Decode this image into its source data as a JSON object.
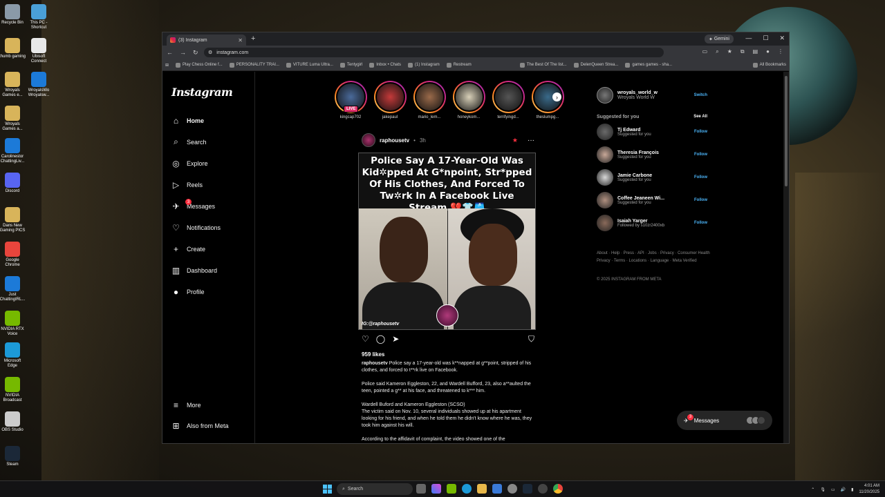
{
  "desktop": {
    "icons": [
      {
        "label": "Recycle Bin",
        "color": "#8a9aa8"
      },
      {
        "label": "This PC - Shortcut",
        "color": "#4aa0d8"
      },
      {
        "label": "thumb gaming",
        "color": "#d8b45a"
      },
      {
        "label": "Ubisoft Connect",
        "color": "#e8e8e8"
      },
      {
        "label": "Wroyals Games e...",
        "color": "#d8b45a"
      },
      {
        "label": "WroyalsWo Wroyalsw...",
        "color": "#1c7ad8"
      },
      {
        "label": "Wroyals Games a...",
        "color": "#d8b45a"
      },
      {
        "label": "Carolinestor ChattingLiv...",
        "color": "#1c7ad8"
      },
      {
        "label": "Discord",
        "color": "#5865f2"
      },
      {
        "label": "Dans New Gaming PICS",
        "color": "#d8b45a"
      },
      {
        "label": "Google Chrome",
        "color": "#e8453c"
      },
      {
        "label": "Just ChattingIRL...",
        "color": "#1c7ad8"
      },
      {
        "label": "NVIDIA RTX Voice",
        "color": "#76b900"
      },
      {
        "label": "Microsoft Edge",
        "color": "#1c9ad8"
      },
      {
        "label": "NVIDIA Broadcast",
        "color": "#76b900"
      },
      {
        "label": "OBS Studio",
        "color": "#cccccc"
      },
      {
        "label": "Steam",
        "color": "#1b2838"
      }
    ]
  },
  "browser": {
    "tab_title": "(3) Instagram",
    "gemini_label": "Gemini",
    "url": "instagram.com",
    "bookmarks": [
      "Play Chess Online f...",
      "PERSONALITY TRAI...",
      "VITURE Luma Ultra...",
      "Tentygirl",
      "Inbox • Chats",
      "(1) Instagram",
      "Restream",
      "The Best Of The list...",
      "DelenQueen Strea...",
      "games games - sha...",
      "All Bookmarks"
    ]
  },
  "instagram": {
    "logo": "Instagram",
    "nav": [
      {
        "label": "Home",
        "icon": "⌂"
      },
      {
        "label": "Search",
        "icon": "⌕"
      },
      {
        "label": "Explore",
        "icon": "◎"
      },
      {
        "label": "Reels",
        "icon": "▷"
      },
      {
        "label": "Messages",
        "icon": "✈"
      },
      {
        "label": "Notifications",
        "icon": "♡"
      },
      {
        "label": "Create",
        "icon": "+"
      },
      {
        "label": "Dashboard",
        "icon": "▥"
      },
      {
        "label": "Profile",
        "icon": "●"
      }
    ],
    "messages_badge": "3",
    "more_label": "More",
    "also_meta_label": "Also from Meta",
    "stories": [
      {
        "name": "kingcap702",
        "color": "#4a6a9a"
      },
      {
        "name": "jakepaul",
        "color": "#c43a3a"
      },
      {
        "name": "mario_lem...",
        "color": "#9a6a4a"
      },
      {
        "name": "honeykom...",
        "color": "#d8d0b8"
      },
      {
        "name": "terrifyingd...",
        "color": "#555"
      },
      {
        "name": "theslumpg...",
        "color": "#3a6a8a"
      }
    ],
    "live_label": "LIVE",
    "post": {
      "username": "raphousetv",
      "time": "3h",
      "headline": "Police Say A 17-Year-Old Was Kid✲pped At G*npoint, Str*pped Of His Clothes, And Forced To Tw✲rk In A Facebook Live Stream.💔👕🩳",
      "watermark": "IG:@raphousetv",
      "likes": "959 likes",
      "caption": [
        "Police say a 17-year-old was k**napped at g**point, stripped of his clothes, and forced to t**rk live on Facebook.",
        "Police said Kameron Eggleston, 22, and Wardell Bufford, 23, also a**aulted the teen, pointed a g** at his face, and threatened to k*** him.",
        "Wardell Buford and Kameron Eggleston (SCSO)\nThe victim said on Nov. 10, several individuals showed up at his apartment looking for his friend, and when he told them he didn't know where he was, they took him against his will.",
        "According to the affidavit of complaint, the video showed one of the"
      ]
    },
    "me": {
      "username": "wroyals_world_w",
      "name": "Wroyals World W",
      "switch": "Switch"
    },
    "suggested_title": "Suggested for you",
    "see_all": "See All",
    "suggestions": [
      {
        "name": "Tj Edward",
        "sub": "Suggested for you",
        "follow": "Follow"
      },
      {
        "name": "Theresia François",
        "sub": "Suggested for you",
        "follow": "Follow"
      },
      {
        "name": "Jamie Carbone",
        "sub": "Suggested for you",
        "follow": "Follow"
      },
      {
        "name": "Coffee Jeaneen Wi...",
        "sub": "Suggested for you",
        "follow": "Follow"
      },
      {
        "name": "Isaiah Yarger",
        "sub": "Followed by s10zr2400xb",
        "follow": "Follow"
      }
    ],
    "footer_links": "About · Help · Press · API · Jobs · Privacy · Consumer Health Privacy · Terms · Locations · Language · Meta Verified",
    "copyright": "© 2025 INSTAGRAM FROM META",
    "messages_pill": "Messages",
    "messages_pill_badge": "3"
  },
  "taskbar": {
    "search_placeholder": "Search",
    "time": "4:01 AM",
    "date": "11/20/2025"
  }
}
